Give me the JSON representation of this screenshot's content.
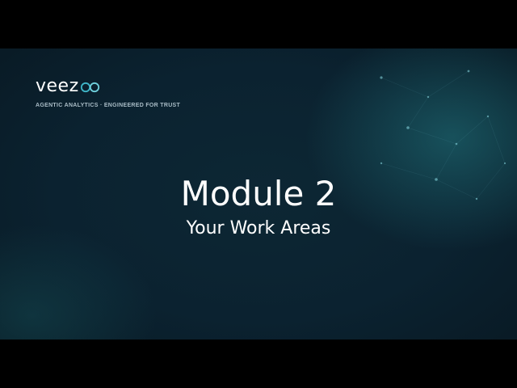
{
  "brand": {
    "name": "veez",
    "mark_icon": "infinity-loop-icon",
    "tagline": "AGENTIC ANALYTICS · ENGINEERED FOR TRUST",
    "accent_color": "#3fb6c8"
  },
  "slide": {
    "title": "Module 2",
    "subtitle": "Your Work Areas",
    "background_color": "#0b2230"
  }
}
